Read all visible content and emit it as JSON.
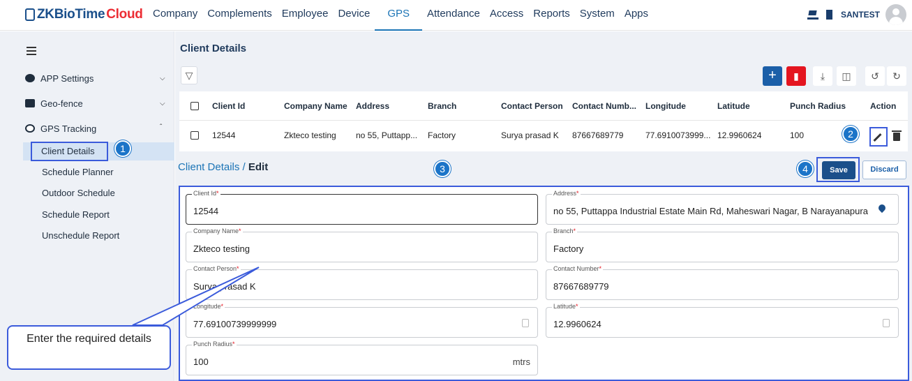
{
  "brand": {
    "main": "ZKBioTime",
    "accent": "Cloud"
  },
  "nav": [
    "Company",
    "Complements",
    "Employee",
    "Device",
    "GPS",
    "Attendance",
    "Access",
    "Reports",
    "System",
    "Apps"
  ],
  "nav_active": "GPS",
  "user": {
    "name": "SANTEST"
  },
  "sidebar": {
    "groups": [
      {
        "label": "APP Settings",
        "icon": "gear-icon"
      },
      {
        "label": "Geo-fence",
        "icon": "message-icon"
      },
      {
        "label": "GPS Tracking",
        "icon": "gps-target-icon"
      }
    ],
    "items": [
      "Client Details",
      "Schedule Planner",
      "Outdoor Schedule",
      "Schedule Report",
      "Unschedule Report"
    ]
  },
  "page": {
    "title": "Client Details"
  },
  "table": {
    "headers": [
      "Client Id",
      "Company Name",
      "Address",
      "Branch",
      "Contact Person",
      "Contact Numb...",
      "Longitude",
      "Latitude",
      "Punch Radius",
      "Action"
    ],
    "row": [
      "12544",
      "Zkteco testing",
      "no 55, Puttapp...",
      "Factory",
      "Surya prasad K",
      "87667689779",
      "77.6910073999...",
      "12.9960624",
      "100"
    ]
  },
  "edit": {
    "breadcrumb": "Client Details",
    "separator": "/",
    "current": "Edit",
    "save": "Save",
    "discard": "Discard"
  },
  "form": {
    "client_id": {
      "label": "Client Id",
      "value": "12544"
    },
    "address": {
      "label": "Address",
      "value": "no 55, Puttappa Industrial Estate Main Rd, Maheswari Nagar, B Narayanapura"
    },
    "company_name": {
      "label": "Company Name",
      "value": "Zkteco testing"
    },
    "branch": {
      "label": "Branch",
      "value": "Factory"
    },
    "contact_person": {
      "label": "Contact Person",
      "value": "Surya prasad K"
    },
    "contact_number": {
      "label": "Contact Number",
      "value": "87667689779"
    },
    "longitude": {
      "label": "Longitude",
      "value": "77.69100739999999"
    },
    "latitude": {
      "label": "Latitude",
      "value": "12.9960624"
    },
    "punch_radius": {
      "label": "Punch Radius",
      "value": "100",
      "suffix": "mtrs"
    },
    "required_mark": "*"
  },
  "annotations": {
    "badges": [
      "1",
      "2",
      "3",
      "4"
    ],
    "callout": "Enter the required details"
  },
  "colors": {
    "primary": "#1b5fa8",
    "danger": "#e4151f",
    "annotation": "#3b5bdb",
    "badge": "#1b74c8"
  }
}
